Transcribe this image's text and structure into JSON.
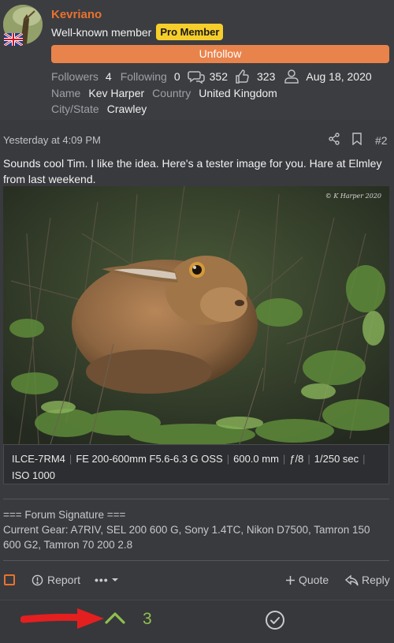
{
  "user": {
    "name": "Kevriano",
    "title": "Well-known member",
    "badge": "Pro Member",
    "unfollow_label": "Unfollow",
    "followers_label": "Followers",
    "followers_count": "4",
    "following_label": "Following",
    "following_count": "0",
    "messages_count": "352",
    "reactions_count": "323",
    "joined_date": "Aug 18, 2020",
    "name_label": "Name",
    "name_value": "Kev Harper",
    "country_label": "Country",
    "country_value": "United Kingdom",
    "city_label": "City/State",
    "city_value": "Crawley"
  },
  "post": {
    "date": "Yesterday at 4:09 PM",
    "number": "#2",
    "text": "Sounds cool Tim. I like the idea. Here's a tester image for you. Hare at Elmley from last weekend.",
    "watermark": "© K Harper 2020"
  },
  "exif": {
    "camera": "ILCE-7RM4",
    "lens": "FE 200-600mm F5.6-6.3 G OSS",
    "focal": "600.0 mm",
    "aperture": "ƒ/8",
    "shutter": "1/250 sec",
    "iso": "ISO 1000"
  },
  "signature": {
    "heading": "=== Forum Signature ===",
    "text": "Current Gear: A7RIV, SEL 200 600 G, Sony 1.4TC, Nikon D7500, Tamron 150 600 G2, Tamron 70 200 2.8"
  },
  "actions": {
    "report_label": "Report",
    "more_label": "•••",
    "quote_label": "Quote",
    "reply_label": "Reply"
  },
  "votes": {
    "count": "3"
  },
  "colors": {
    "accent": "#e9722f",
    "badge": "#f6ce2c",
    "vote": "#8fc04e",
    "arrow": "#e41f1f"
  }
}
